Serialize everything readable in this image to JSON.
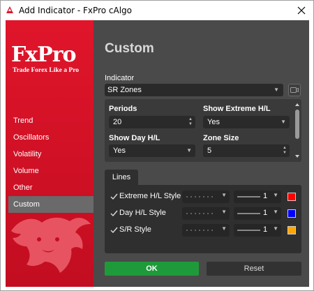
{
  "window": {
    "title": "Add Indicator - FxPro cAlgo",
    "close_glyph": "✕"
  },
  "brand": {
    "logo": "FxPro",
    "tagline": "Trade Forex Like a Pro",
    "color": "#e0152b"
  },
  "sidebar": {
    "items": [
      {
        "label": "Trend"
      },
      {
        "label": "Oscillators"
      },
      {
        "label": "Volatility"
      },
      {
        "label": "Volume"
      },
      {
        "label": "Other"
      },
      {
        "label": "Custom",
        "active": true
      }
    ]
  },
  "main": {
    "heading": "Custom",
    "indicator_label": "Indicator",
    "indicator_value": "SR Zones"
  },
  "params": {
    "periods_label": "Periods",
    "periods_value": "20",
    "show_extreme_label": "Show Extreme H/L",
    "show_extreme_value": "Yes",
    "show_day_label": "Show Day H/L",
    "show_day_value": "Yes",
    "zone_size_label": "Zone Size",
    "zone_size_value": "5"
  },
  "lines": {
    "tab_label": "Lines",
    "rows": [
      {
        "label": "Extreme H/L Style",
        "width": "1",
        "color": "#ff0000",
        "checked": true
      },
      {
        "label": "Day H/L Style",
        "width": "1",
        "color": "#0000ff",
        "checked": true
      },
      {
        "label": "S/R Style",
        "width": "1",
        "color": "#ffa500",
        "checked": true
      }
    ]
  },
  "buttons": {
    "ok": "OK",
    "reset": "Reset"
  },
  "colors": {
    "ok_green": "#1f9a3a",
    "panel_bg": "#4a4a4a"
  }
}
